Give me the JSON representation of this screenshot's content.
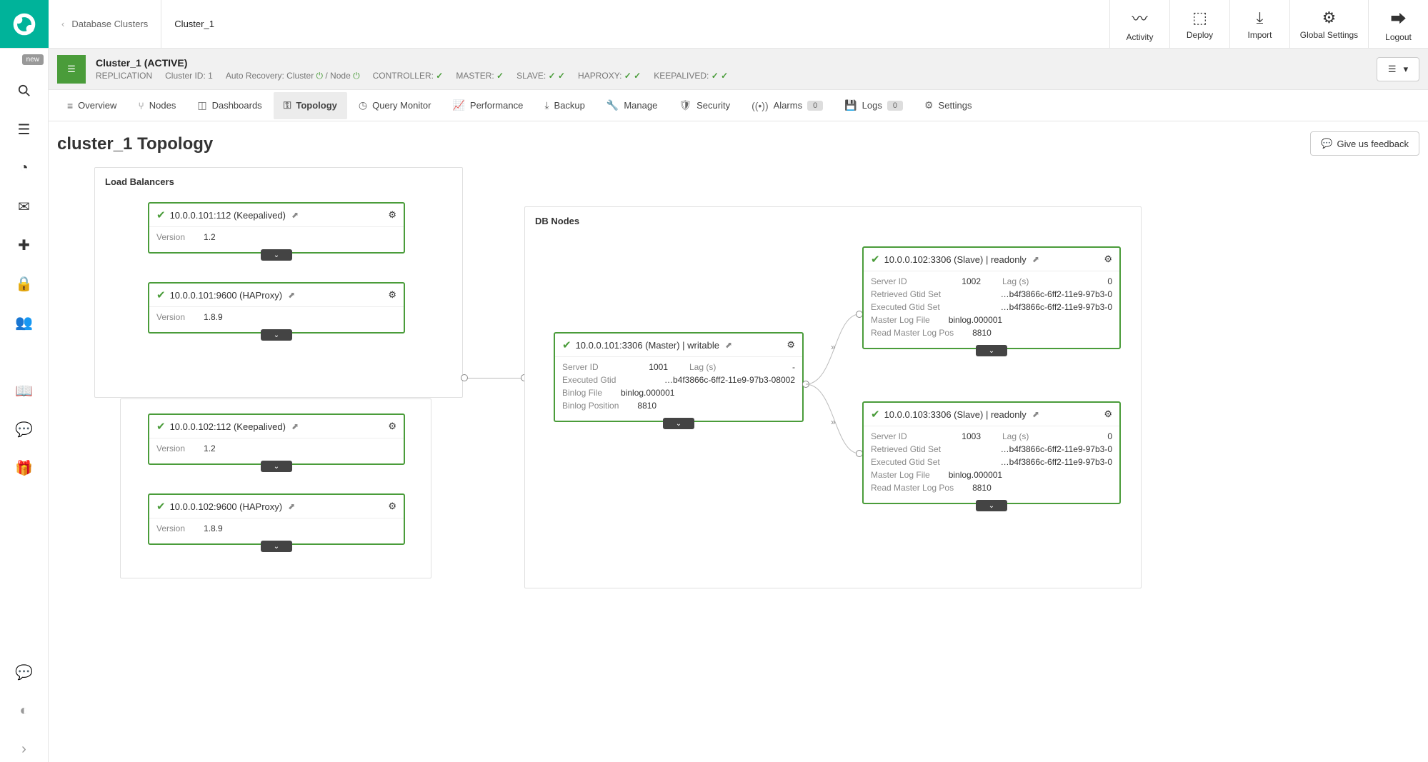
{
  "top": {
    "breadcrumb_parent": "Database Clusters",
    "breadcrumb_current": "Cluster_1",
    "actions": {
      "activity": "Activity",
      "deploy": "Deploy",
      "import": "Import",
      "global_settings": "Global Settings",
      "logout": "Logout"
    }
  },
  "rail": {
    "new_badge": "new"
  },
  "cluster": {
    "title": "Cluster_1 (ACTIVE)",
    "replication": "REPLICATION",
    "cluster_id_label": "Cluster ID: 1",
    "auto_recovery_label": "Auto Recovery: Cluster",
    "auto_recovery_node": "/ Node",
    "controller_label": "CONTROLLER:",
    "master_label": "MASTER:",
    "slave_label": "SLAVE:",
    "haproxy_label": "HAPROXY:",
    "keepalived_label": "KEEPALIVED:"
  },
  "tabs": {
    "overview": "Overview",
    "nodes": "Nodes",
    "dashboards": "Dashboards",
    "topology": "Topology",
    "query_monitor": "Query Monitor",
    "performance": "Performance",
    "backup": "Backup",
    "manage": "Manage",
    "security": "Security",
    "alarms": "Alarms",
    "alarms_count": "0",
    "logs": "Logs",
    "logs_count": "0",
    "settings": "Settings"
  },
  "page": {
    "title": "cluster_1 Topology",
    "feedback": "Give us feedback",
    "lb_title": "Load Balancers",
    "db_title": "DB Nodes"
  },
  "lb": [
    {
      "title": "10.0.0.101:112 (Keepalived)",
      "version_label": "Version",
      "version": "1.2"
    },
    {
      "title": "10.0.0.101:9600 (HAProxy)",
      "version_label": "Version",
      "version": "1.8.9"
    },
    {
      "title": "10.0.0.102:112 (Keepalived)",
      "version_label": "Version",
      "version": "1.2"
    },
    {
      "title": "10.0.0.102:9600 (HAProxy)",
      "version_label": "Version",
      "version": "1.8.9"
    }
  ],
  "master": {
    "title": "10.0.0.101:3306 (Master) | writable",
    "server_id_label": "Server ID",
    "server_id": "1001",
    "lag_label": "Lag (s)",
    "lag": "-",
    "executed_gtid_label": "Executed Gtid",
    "executed_gtid": "…b4f3866c-6ff2-11e9-97b3-08002",
    "binlog_file_label": "Binlog File",
    "binlog_file": "binlog.000001",
    "binlog_pos_label": "Binlog Position",
    "binlog_pos": "8810"
  },
  "slaves": [
    {
      "title": "10.0.0.102:3306 (Slave) | readonly",
      "server_id_label": "Server ID",
      "server_id": "1002",
      "lag_label": "Lag (s)",
      "lag": "0",
      "retrieved_label": "Retrieved Gtid Set",
      "retrieved": "…b4f3866c-6ff2-11e9-97b3-0",
      "executed_label": "Executed Gtid Set",
      "executed": "…b4f3866c-6ff2-11e9-97b3-0",
      "mlf_label": "Master Log File",
      "mlf": "binlog.000001",
      "rmlp_label": "Read Master Log Pos",
      "rmlp": "8810"
    },
    {
      "title": "10.0.0.103:3306 (Slave) | readonly",
      "server_id_label": "Server ID",
      "server_id": "1003",
      "lag_label": "Lag (s)",
      "lag": "0",
      "retrieved_label": "Retrieved Gtid Set",
      "retrieved": "…b4f3866c-6ff2-11e9-97b3-0",
      "executed_label": "Executed Gtid Set",
      "executed": "…b4f3866c-6ff2-11e9-97b3-0",
      "mlf_label": "Master Log File",
      "mlf": "binlog.000001",
      "rmlp_label": "Read Master Log Pos",
      "rmlp": "8810"
    }
  ]
}
